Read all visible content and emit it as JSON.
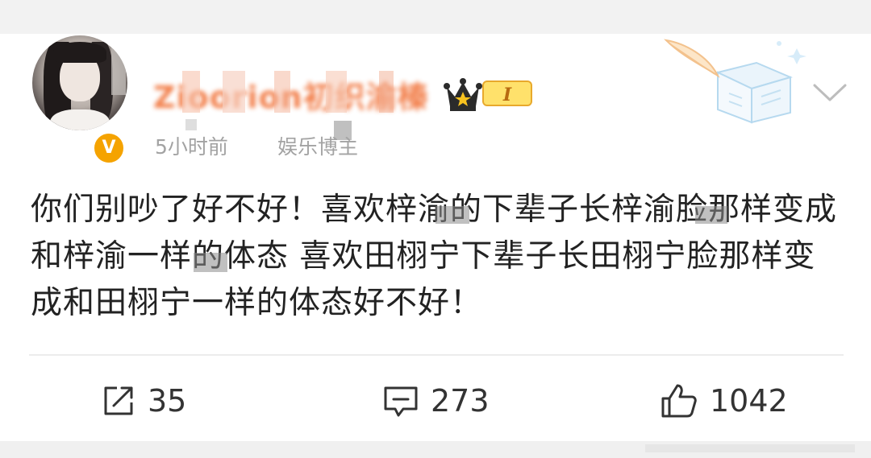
{
  "post": {
    "author": {
      "name": "Zioorion初织渝榛",
      "verified_badge": "V",
      "level_badge": "I"
    },
    "meta": {
      "time": "5小时前",
      "source": "娱乐博主"
    },
    "text": "你们别吵了好不好！喜欢梓渝的下辈子长梓渝脸那样变成和梓渝一样的体态 喜欢田栩宁下辈子长田栩宁脸那样变成和田栩宁一样的体态好不好！",
    "actions": {
      "share_count": "35",
      "comment_count": "273",
      "like_count": "1042"
    }
  },
  "colors": {
    "username": "#f06a2d",
    "meta_text": "#a3a3a3",
    "body_text": "#222222",
    "verified_badge": "#f5a300"
  },
  "icons": {
    "share": "share-icon",
    "comment": "comment-icon",
    "like": "thumbs-up-icon",
    "expand": "chevron-down-icon"
  }
}
